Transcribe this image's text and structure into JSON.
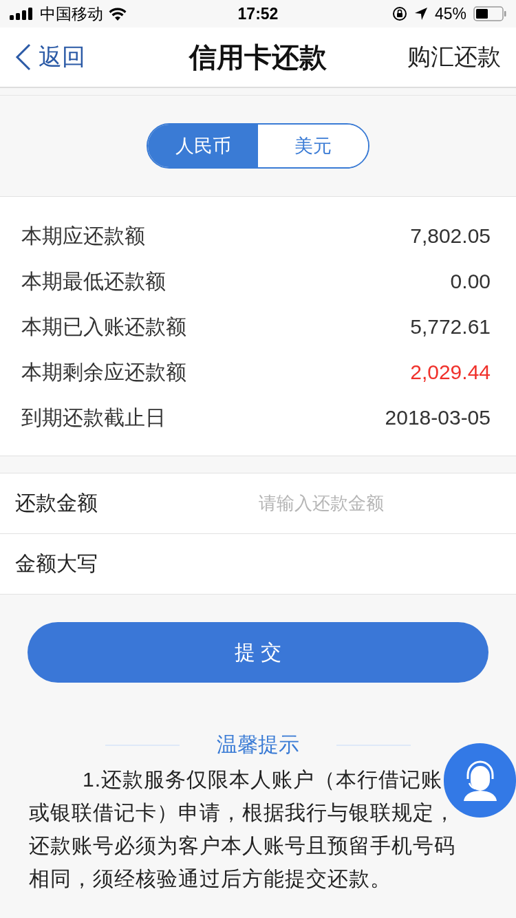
{
  "status_bar": {
    "carrier": "中国移动",
    "time": "17:52",
    "battery": "45%"
  },
  "nav": {
    "back": "返回",
    "title": "信用卡还款",
    "action": "购汇还款"
  },
  "currency_tabs": [
    {
      "label": "人民币",
      "selected": true
    },
    {
      "label": "美元",
      "selected": false
    }
  ],
  "summary": [
    {
      "label": "本期应还款额",
      "value": "7,802.05",
      "highlight": false
    },
    {
      "label": "本期最低还款额",
      "value": "0.00",
      "highlight": false
    },
    {
      "label": "本期已入账还款额",
      "value": "5,772.61",
      "highlight": false
    },
    {
      "label": "本期剩余应还款额",
      "value": "2,029.44",
      "highlight": true
    },
    {
      "label": "到期还款截止日",
      "value": "2018-03-05",
      "highlight": false
    }
  ],
  "form": [
    {
      "label": "还款金额",
      "placeholder": "请输入还款金额"
    },
    {
      "label": "金额大写"
    }
  ],
  "submit": "提 交",
  "tips": {
    "title": "温馨提示",
    "paragraphs": [
      "1.还款服务仅限本人账户（本行借记账或银联借记卡）申请，根据我行与银联规定，还款账号必须为客户本人账号且预留手机号码相同，须经核验通过后方能提交还款。"
    ]
  }
}
